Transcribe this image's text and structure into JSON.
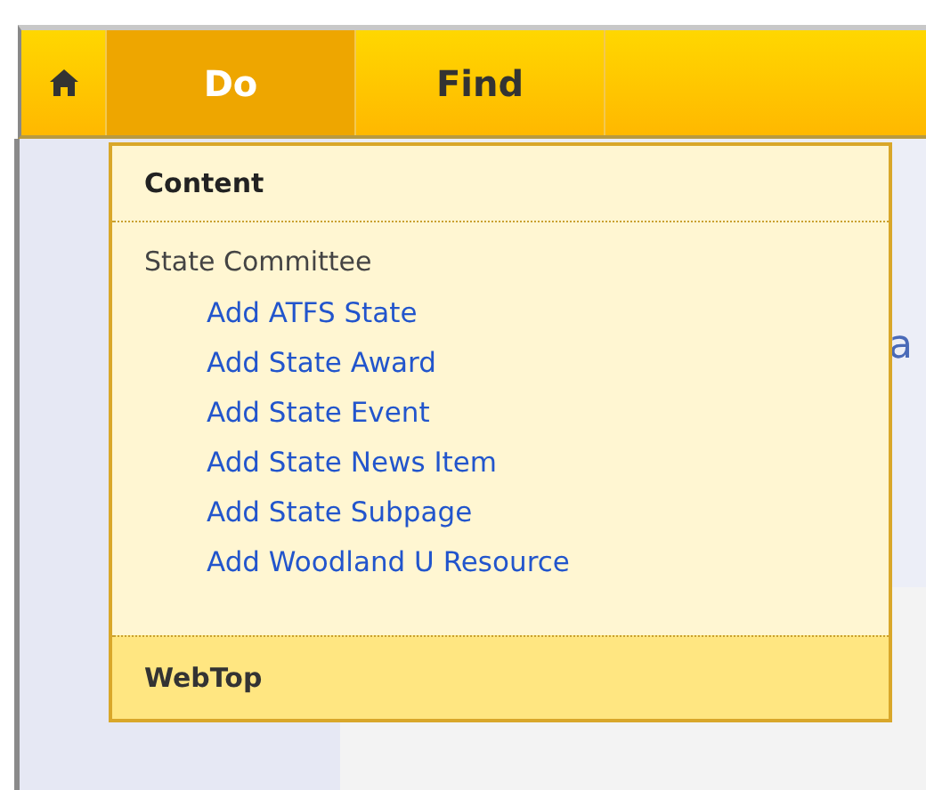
{
  "nav": {
    "tabs": [
      {
        "kind": "home",
        "selected": false
      },
      {
        "kind": "text",
        "label": "Do",
        "selected": true
      },
      {
        "kind": "text",
        "label": "Find",
        "selected": false
      }
    ]
  },
  "background_texts": [
    "a"
  ],
  "menu": {
    "header": "Content",
    "group": "State Committee",
    "items": [
      "Add ATFS State",
      "Add State Award",
      "Add State Event",
      "Add State News Item",
      "Add State Subpage",
      "Add Woodland U Resource"
    ],
    "footer": "WebTop"
  }
}
